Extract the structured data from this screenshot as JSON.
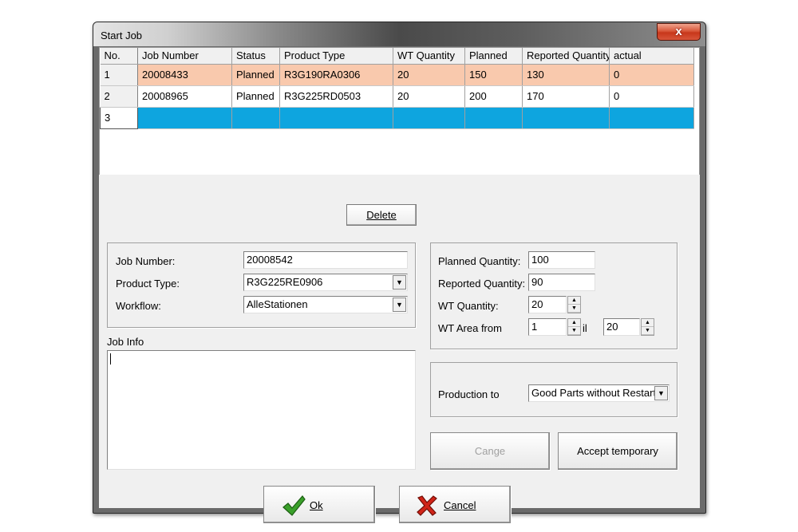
{
  "window": {
    "title": "Start Job",
    "close_label": "x"
  },
  "grid": {
    "columns": [
      "No.",
      "Job Number",
      "Status",
      "Product Type",
      "WT Quantity",
      "Planned",
      "Reported Quantity",
      "actual"
    ],
    "rows": [
      [
        "1",
        "20008433",
        "Planned",
        "R3G190RA0306",
        "20",
        "150",
        "130",
        "0"
      ],
      [
        "2",
        "20008965",
        "Planned",
        "R3G225RD0503",
        "20",
        "200",
        "170",
        "0"
      ],
      [
        "3",
        "",
        "",
        "",
        "",
        "",
        "",
        ""
      ]
    ],
    "highlight_color": "#f9c9ad",
    "selected_color": "#0ea5df"
  },
  "delete_button": {
    "label": "Delete"
  },
  "job_form": {
    "job_number_label": "Job Number:",
    "job_number_value": "20008542",
    "product_type_label": "Product Type:",
    "product_type_value": "R3G225RE0906",
    "workflow_label": "Workflow:",
    "workflow_value": "AlleStationen"
  },
  "job_info": {
    "label": "Job Info",
    "value": ""
  },
  "quantities": {
    "planned_label": "Planned Quantity:",
    "planned_value": "100",
    "reported_label": "Reported Quantity:",
    "reported_value": "90",
    "wt_label": "WT Quantity:",
    "wt_value": "20",
    "wt_area_label": "WT Area from",
    "wt_area_from": "1",
    "wt_area_until_label": "il",
    "wt_area_to": "20"
  },
  "production": {
    "label": "Production to",
    "value": "Good Parts without Restart"
  },
  "buttons": {
    "cange": "Cange",
    "accept_temporary": "Accept temporary",
    "ok": "Ok",
    "cancel": "Cancel"
  }
}
